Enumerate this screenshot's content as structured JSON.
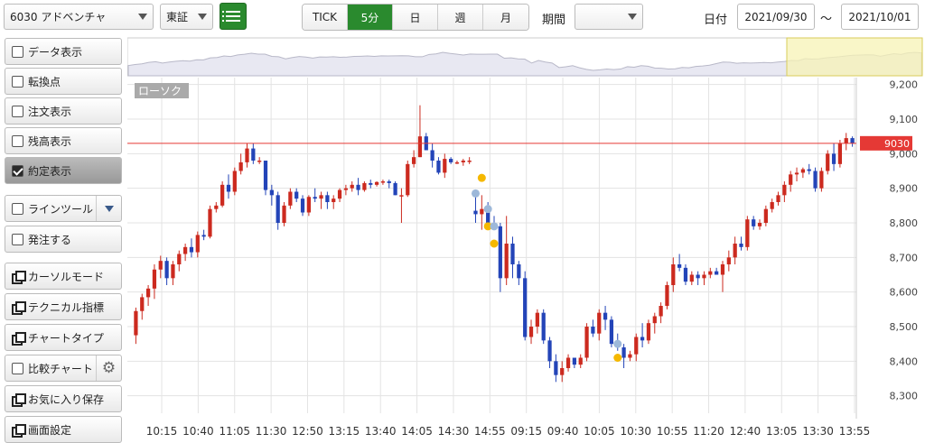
{
  "toolbar": {
    "symbol_select": "6030 アドベンチャ",
    "market_select": "東証",
    "list_icon": "list-icon",
    "timeframes": [
      {
        "label": "TICK",
        "active": false
      },
      {
        "label": "5分",
        "active": true
      },
      {
        "label": "日",
        "active": false
      },
      {
        "label": "週",
        "active": false
      },
      {
        "label": "月",
        "active": false
      }
    ],
    "period_label": "期間",
    "period_value": "",
    "date_label": "日付",
    "date_from": "2021/09/30",
    "date_sep": "〜",
    "date_to": "2021/10/01"
  },
  "sidebar": {
    "items": [
      {
        "label": "データ表示",
        "kind": "checkbox",
        "checked": false
      },
      {
        "label": "転換点",
        "kind": "checkbox",
        "checked": false
      },
      {
        "label": "注文表示",
        "kind": "checkbox",
        "checked": false
      },
      {
        "label": "残高表示",
        "kind": "checkbox",
        "checked": false
      },
      {
        "label": "約定表示",
        "kind": "checkbox",
        "checked": true
      },
      {
        "label": "ラインツール",
        "kind": "checkbox-dropdown",
        "checked": false
      },
      {
        "label": "発注する",
        "kind": "checkbox",
        "checked": false
      },
      {
        "label": "カーソルモード",
        "kind": "window"
      },
      {
        "label": "テクニカル指標",
        "kind": "window"
      },
      {
        "label": "チャートタイプ",
        "kind": "window"
      },
      {
        "label": "比較チャート",
        "kind": "checkbox-gear",
        "checked": false
      },
      {
        "label": "お気に入り保存",
        "kind": "window"
      },
      {
        "label": "画面設定",
        "kind": "window"
      }
    ]
  },
  "colors": {
    "up": "#cc2a1f",
    "down": "#2344b8",
    "accent": "#2a8a2e",
    "price_line": "#e53935",
    "buy_marker": "#f5b800",
    "sell_marker": "#9db8d9",
    "navigator_fill": "#e8e8f2",
    "navigator_highlight": "#f7f3b5"
  },
  "chart_data": {
    "type": "candlestick",
    "chart_label": "ローソク",
    "current_price": "9030",
    "current_price_value": 9030,
    "ylim": [
      8260,
      9220
    ],
    "y_ticks": [
      "9,200",
      "9,100",
      "9,000",
      "8,900",
      "8,800",
      "8,700",
      "8,600",
      "8,500",
      "8,400",
      "8,300"
    ],
    "x_ticks": [
      "10:15",
      "10:40",
      "11:05",
      "11:30",
      "12:50",
      "13:15",
      "13:40",
      "14:05",
      "14:30",
      "14:55",
      "09:15",
      "09:40",
      "10:05",
      "10:30",
      "10:55",
      "11:20",
      "12:40",
      "13:05",
      "13:30",
      "13:55"
    ],
    "candles": [
      [
        8475,
        8555,
        8450,
        8545
      ],
      [
        8545,
        8595,
        8520,
        8585
      ],
      [
        8585,
        8620,
        8560,
        8610
      ],
      [
        8610,
        8680,
        8580,
        8665
      ],
      [
        8665,
        8705,
        8640,
        8690
      ],
      [
        8690,
        8700,
        8620,
        8640
      ],
      [
        8640,
        8690,
        8620,
        8680
      ],
      [
        8680,
        8720,
        8660,
        8710
      ],
      [
        8710,
        8740,
        8690,
        8730
      ],
      [
        8730,
        8755,
        8700,
        8715
      ],
      [
        8715,
        8775,
        8700,
        8765
      ],
      [
        8765,
        8780,
        8750,
        8760
      ],
      [
        8760,
        8850,
        8755,
        8840
      ],
      [
        8840,
        8860,
        8830,
        8850
      ],
      [
        8850,
        8920,
        8845,
        8910
      ],
      [
        8910,
        8940,
        8870,
        8890
      ],
      [
        8890,
        8960,
        8880,
        8950
      ],
      [
        8950,
        9000,
        8940,
        8975
      ],
      [
        8975,
        9030,
        8960,
        9015
      ],
      [
        9015,
        9030,
        8970,
        8980
      ],
      [
        8980,
        8990,
        8970,
        8980
      ],
      [
        8980,
        8970,
        8880,
        8895
      ],
      [
        8895,
        8910,
        8850,
        8880
      ],
      [
        8880,
        8890,
        8780,
        8800
      ],
      [
        8800,
        8860,
        8790,
        8850
      ],
      [
        8850,
        8900,
        8840,
        8890
      ],
      [
        8890,
        8900,
        8860,
        8870
      ],
      [
        8870,
        8880,
        8820,
        8830
      ],
      [
        8830,
        8880,
        8820,
        8875
      ],
      [
        8875,
        8900,
        8860,
        8870
      ],
      [
        8870,
        8890,
        8840,
        8880
      ],
      [
        8880,
        8890,
        8840,
        8860
      ],
      [
        8860,
        8880,
        8840,
        8870
      ],
      [
        8870,
        8900,
        8860,
        8895
      ],
      [
        8895,
        8910,
        8880,
        8900
      ],
      [
        8900,
        8920,
        8890,
        8910
      ],
      [
        8910,
        8930,
        8880,
        8895
      ],
      [
        8895,
        8920,
        8890,
        8915
      ],
      [
        8915,
        8925,
        8900,
        8910
      ],
      [
        8910,
        8920,
        8905,
        8918
      ],
      [
        8918,
        8925,
        8910,
        8920
      ],
      [
        8920,
        8925,
        8900,
        8915
      ],
      [
        8915,
        8920,
        8880,
        8880
      ],
      [
        8880,
        8900,
        8800,
        8880
      ],
      [
        8880,
        8980,
        8875,
        8970
      ],
      [
        8970,
        9010,
        8960,
        8990
      ],
      [
        8990,
        9140,
        8990,
        9050
      ],
      [
        9050,
        9060,
        9010,
        9010
      ],
      [
        9010,
        9030,
        8960,
        8980
      ],
      [
        8980,
        8990,
        8940,
        8945
      ],
      [
        8945,
        9000,
        8930,
        8985
      ],
      [
        8985,
        8990,
        8970,
        8975
      ],
      [
        8975,
        8980,
        8970,
        8975
      ],
      [
        8975,
        8985,
        8965,
        8980
      ],
      [
        8980,
        8990,
        8970,
        8980
      ],
      [
        8835,
        8880,
        8800,
        8825
      ],
      [
        8825,
        8880,
        8780,
        8840
      ],
      [
        8840,
        8860,
        8780,
        8800
      ],
      [
        8800,
        8820,
        8780,
        8790
      ],
      [
        8790,
        8800,
        8600,
        8640
      ],
      [
        8640,
        8820,
        8620,
        8740
      ],
      [
        8740,
        8760,
        8640,
        8680
      ],
      [
        8680,
        8690,
        8620,
        8640
      ],
      [
        8640,
        8660,
        8460,
        8470
      ],
      [
        8470,
        8520,
        8450,
        8500
      ],
      [
        8500,
        8550,
        8480,
        8540
      ],
      [
        8540,
        8550,
        8450,
        8460
      ],
      [
        8460,
        8470,
        8380,
        8400
      ],
      [
        8400,
        8420,
        8340,
        8360
      ],
      [
        8360,
        8400,
        8340,
        8380
      ],
      [
        8380,
        8420,
        8370,
        8410
      ],
      [
        8410,
        8410,
        8380,
        8390
      ],
      [
        8390,
        8420,
        8380,
        8410
      ],
      [
        8410,
        8510,
        8400,
        8500
      ],
      [
        8500,
        8520,
        8470,
        8480
      ],
      [
        8480,
        8550,
        8460,
        8540
      ],
      [
        8540,
        8560,
        8490,
        8520
      ],
      [
        8520,
        8530,
        8440,
        8450
      ],
      [
        8450,
        8480,
        8430,
        8440
      ],
      [
        8440,
        8450,
        8380,
        8410
      ],
      [
        8410,
        8430,
        8400,
        8420
      ],
      [
        8420,
        8480,
        8400,
        8470
      ],
      [
        8470,
        8510,
        8440,
        8460
      ],
      [
        8460,
        8520,
        8450,
        8510
      ],
      [
        8510,
        8540,
        8480,
        8530
      ],
      [
        8530,
        8570,
        8510,
        8560
      ],
      [
        8560,
        8630,
        8550,
        8620
      ],
      [
        8620,
        8700,
        8600,
        8680
      ],
      [
        8680,
        8710,
        8660,
        8670
      ],
      [
        8670,
        8680,
        8620,
        8630
      ],
      [
        8630,
        8660,
        8620,
        8650
      ],
      [
        8650,
        8660,
        8620,
        8640
      ],
      [
        8640,
        8660,
        8620,
        8650
      ],
      [
        8650,
        8670,
        8640,
        8660
      ],
      [
        8660,
        8670,
        8650,
        8650
      ],
      [
        8650,
        8690,
        8600,
        8680
      ],
      [
        8680,
        8720,
        8660,
        8700
      ],
      [
        8700,
        8760,
        8680,
        8740
      ],
      [
        8740,
        8760,
        8720,
        8730
      ],
      [
        8730,
        8820,
        8720,
        8810
      ],
      [
        8810,
        8820,
        8780,
        8790
      ],
      [
        8790,
        8810,
        8780,
        8800
      ],
      [
        8800,
        8850,
        8790,
        8840
      ],
      [
        8840,
        8870,
        8830,
        8860
      ],
      [
        8860,
        8890,
        8850,
        8880
      ],
      [
        8880,
        8920,
        8860,
        8910
      ],
      [
        8910,
        8950,
        8890,
        8940
      ],
      [
        8940,
        8960,
        8920,
        8945
      ],
      [
        8945,
        8960,
        8930,
        8955
      ],
      [
        8955,
        8970,
        8940,
        8950
      ],
      [
        8950,
        8960,
        8890,
        8900
      ],
      [
        8900,
        8960,
        8890,
        8950
      ],
      [
        8950,
        9010,
        8940,
        9000
      ],
      [
        9000,
        9030,
        8950,
        8970
      ],
      [
        8970,
        9040,
        8960,
        9030
      ],
      [
        9030,
        9060,
        9010,
        9045
      ],
      [
        9045,
        9050,
        9020,
        9030
      ]
    ],
    "executions": [
      {
        "i": 55,
        "price": 8885,
        "side": "sell"
      },
      {
        "i": 56,
        "price": 8930,
        "side": "buy"
      },
      {
        "i": 57,
        "price": 8840,
        "side": "sell"
      },
      {
        "i": 57,
        "price": 8790,
        "side": "buy"
      },
      {
        "i": 58,
        "price": 8790,
        "side": "sell"
      },
      {
        "i": 58,
        "price": 8740,
        "side": "buy"
      },
      {
        "i": 78,
        "price": 8450,
        "side": "sell"
      },
      {
        "i": 78,
        "price": 8410,
        "side": "buy"
      }
    ]
  }
}
